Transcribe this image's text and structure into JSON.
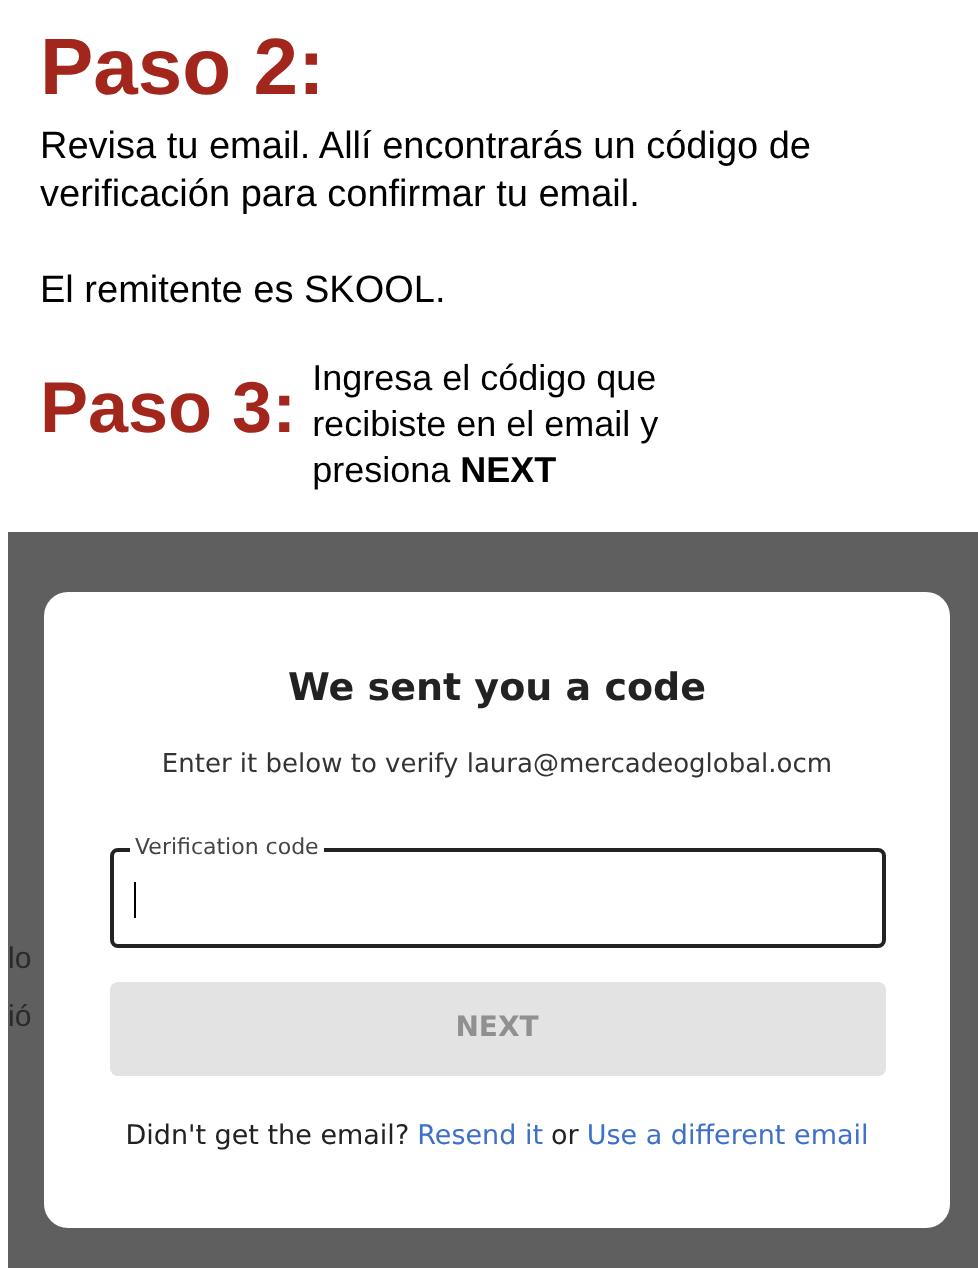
{
  "steps": [
    {
      "heading": "Paso 2:",
      "paragraphs": [
        "Revisa tu email. Allí encontrarás un código de verificación para confirmar tu email.",
        "El remitente es SKOOL."
      ]
    },
    {
      "heading": "Paso 3:",
      "paragraphs": [
        "Ingresa el código que recibiste en el email y presiona **NEXT**"
      ]
    }
  ],
  "screenshot": {
    "background_fragments": [
      "lo",
      "ió"
    ],
    "dialog": {
      "title": "We sent you a code",
      "subtitle": "Enter it below to verify laura@mercadeoglobal.ocm",
      "field": {
        "label": "Verification code",
        "focused": true
      },
      "button": {
        "label": "NEXT",
        "disabled": true
      },
      "footer": {
        "text": "Didn't get the email?",
        "link_1": "Resend it",
        "joiner": "or",
        "link_2": "Use a different email"
      }
    }
  }
}
